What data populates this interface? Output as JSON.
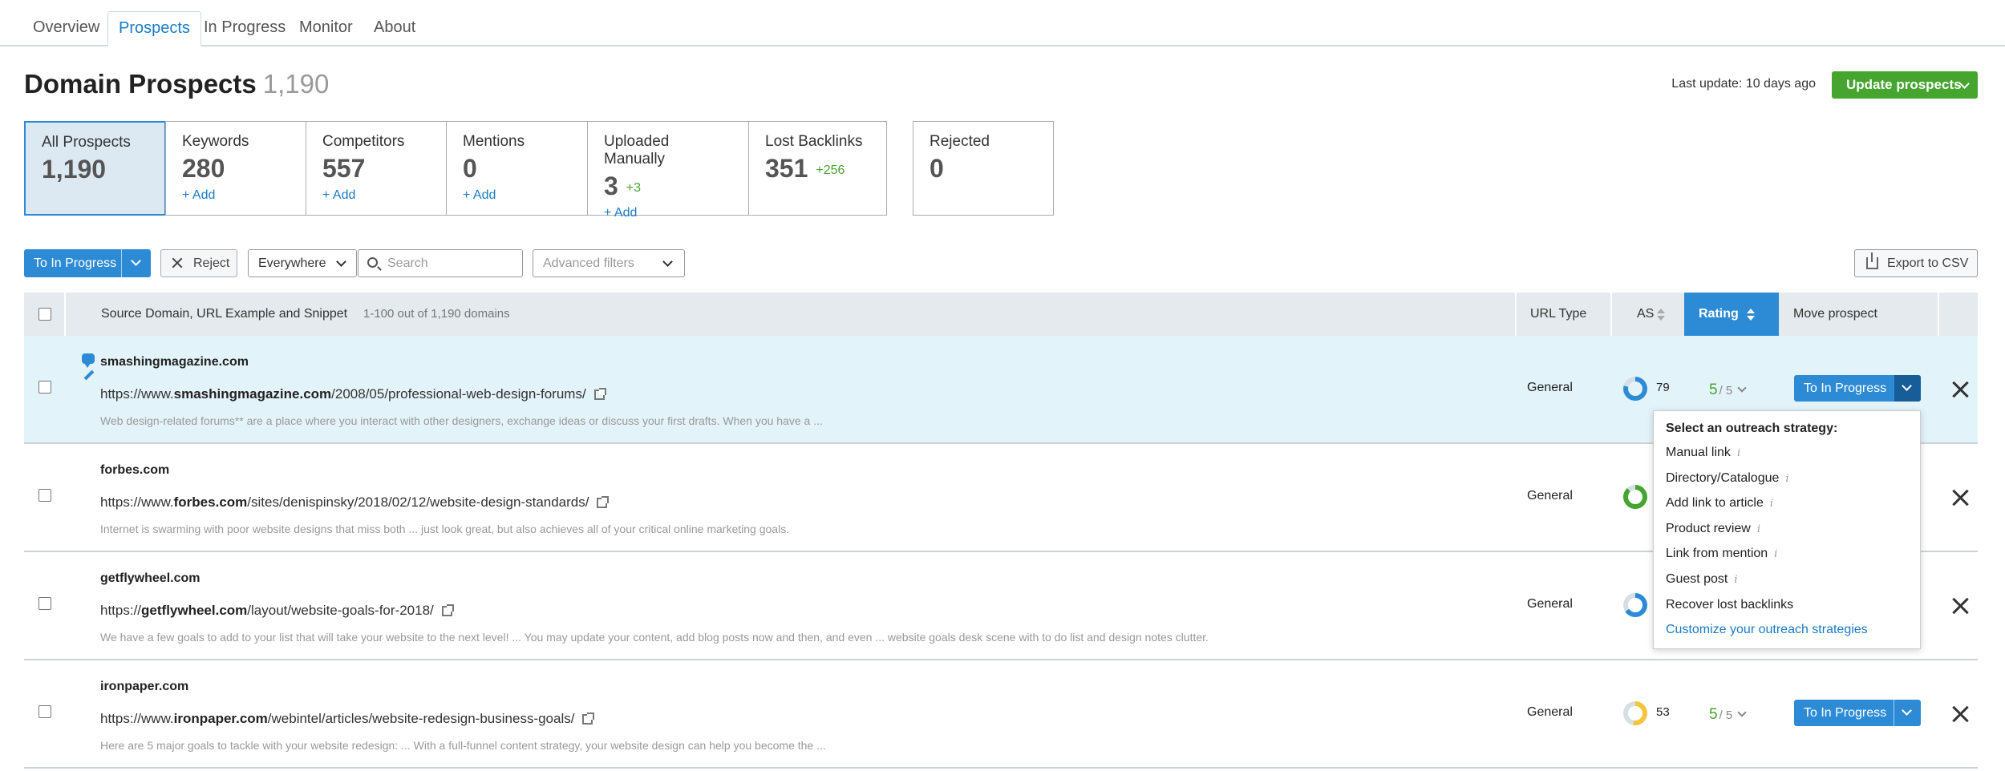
{
  "nav": {
    "tabs": [
      {
        "label": "Overview"
      },
      {
        "label": "Prospects"
      },
      {
        "label": "In Progress"
      },
      {
        "label": "Monitor"
      },
      {
        "label": "About"
      }
    ],
    "active": "Prospects"
  },
  "header": {
    "title": "Domain Prospects",
    "count": "1,190",
    "last_update": "Last update: 10 days ago",
    "update_button": "Update prospects"
  },
  "cards": [
    {
      "label": "All Prospects",
      "value": "1,190",
      "delta": "",
      "add": ""
    },
    {
      "label": "Keywords",
      "value": "280",
      "delta": "",
      "add": "+ Add"
    },
    {
      "label": "Competitors",
      "value": "557",
      "delta": "",
      "add": "+ Add"
    },
    {
      "label": "Mentions",
      "value": "0",
      "delta": "",
      "add": "+ Add"
    },
    {
      "label": "Uploaded Manually",
      "value": "3",
      "delta": "+3",
      "add": "+ Add"
    },
    {
      "label": "Lost Backlinks",
      "value": "351",
      "delta": "+256",
      "add": ""
    },
    {
      "label": "Rejected",
      "value": "0",
      "delta": "",
      "add": ""
    }
  ],
  "toolbar": {
    "to_in_progress": "To In Progress",
    "reject": "Reject",
    "scope": "Everywhere",
    "search_placeholder": "Search",
    "advanced_filters": "Advanced filters",
    "export": "Export to CSV"
  },
  "table": {
    "headers": {
      "source": "Source Domain, URL Example and Snippet",
      "range": "1-100 out of 1,190 domains",
      "url_type": "URL Type",
      "as": "AS",
      "rating": "Rating",
      "move": "Move prospect"
    },
    "rows": [
      {
        "domain": "smashingmagazine.com",
        "url_pre": "https://www.",
        "url_bold": "smashingmagazine.com",
        "url_post": "/2008/05/professional-web-design-forums/",
        "snippet": "Web design-related forums** are a place where you interact with other designers, exchange ideas or discuss your first drafts. When you have a ...",
        "url_type": "General",
        "as": "79",
        "rating": "5",
        "rating_max": "/ 5",
        "action": "To In Progress"
      },
      {
        "domain": "forbes.com",
        "url_pre": "https://www.",
        "url_bold": "forbes.com",
        "url_post": "/sites/denispinsky/2018/02/12/website-design-standards/",
        "snippet": "Internet is swarming with poor website designs that miss both ... just look great, but also achieves all of your critical online marketing goals.",
        "url_type": "General",
        "as": "",
        "rating": "",
        "rating_max": "",
        "action": ""
      },
      {
        "domain": "getflywheel.com",
        "url_pre": "https://",
        "url_bold": "getflywheel.com",
        "url_post": "/layout/website-goals-for-2018/",
        "snippet": "We have a few goals to add to your list that will take your website to the next level! ... You may update your content, add blog posts now and then, and even ... website goals desk scene with to do list and design notes clutter.",
        "url_type": "General",
        "as": "",
        "rating": "",
        "rating_max": "",
        "action": ""
      },
      {
        "domain": "ironpaper.com",
        "url_pre": "https://www.",
        "url_bold": "ironpaper.com",
        "url_post": "/webintel/articles/website-redesign-business-goals/",
        "snippet": "Here are 5 major goals to tackle with your website redesign: ... With a full-funnel content strategy, your website design can help you become the ...",
        "url_type": "General",
        "as": "53",
        "rating": "5",
        "rating_max": "/ 5",
        "action": "To In Progress"
      }
    ]
  },
  "menu": {
    "title": "Select an outreach strategy:",
    "items": [
      {
        "label": "Manual link",
        "info": "i"
      },
      {
        "label": "Directory/Catalogue",
        "info": "i"
      },
      {
        "label": "Add link to article",
        "info": "i"
      },
      {
        "label": "Product review",
        "info": "i"
      },
      {
        "label": "Link from mention",
        "info": "i"
      },
      {
        "label": "Guest post",
        "info": "i"
      },
      {
        "label": "Recover lost backlinks",
        "info": ""
      }
    ],
    "link": "Customize your outreach strategies"
  },
  "colors": {
    "accent": "#2d8bd5",
    "green": "#45a52e",
    "donut_blue": "#2d8bd5",
    "donut_green": "#45a52e",
    "donut_yellow": "#f2c53d"
  }
}
